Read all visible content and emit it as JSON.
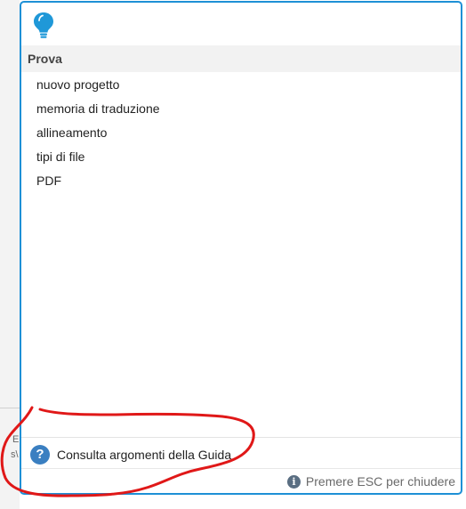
{
  "panel": {
    "icon": "lightbulb-icon",
    "accent_color": "#1e90d6",
    "section_title": "Prova",
    "items": [
      {
        "label": "nuovo progetto"
      },
      {
        "label": "memoria di traduzione"
      },
      {
        "label": "allineamento"
      },
      {
        "label": "tipi di file"
      },
      {
        "label": "PDF"
      }
    ],
    "help_link": "Consulta argomenti della Guida",
    "help_icon": "question-icon",
    "esc_hint": "Premere ESC per chiudere",
    "esc_icon": "info-icon"
  },
  "background": {
    "fragment_1": "E",
    "fragment_2": "s\\"
  },
  "annotation": {
    "color": "#e01818"
  }
}
